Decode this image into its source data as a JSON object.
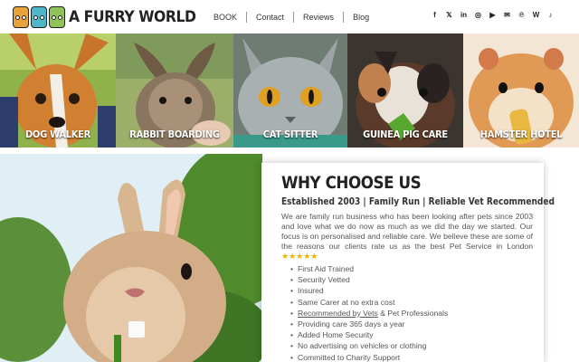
{
  "brand": {
    "name": "A FURRY WORLD"
  },
  "nav": {
    "items": [
      "BOOK",
      "Contact",
      "Reviews",
      "Blog"
    ]
  },
  "social": [
    "f",
    "𝕏",
    "in",
    "◎",
    "▶",
    "✉",
    "℗",
    "W",
    "♪"
  ],
  "social_names": [
    "facebook-icon",
    "x-twitter-icon",
    "linkedin-icon",
    "instagram-icon",
    "youtube-icon",
    "email-icon",
    "pinterest-icon",
    "w-icon",
    "tiktok-icon"
  ],
  "tiles": [
    {
      "label": "DOG WALKER"
    },
    {
      "label": "RABBIT BOARDING"
    },
    {
      "label": "CAT SITTER"
    },
    {
      "label": "GUINEA PIG CARE"
    },
    {
      "label": "HAMSTER HOTEL"
    }
  ],
  "why": {
    "title": "WHY CHOOSE US",
    "subtitle": "Established 2003  | Family Run | Reliable Vet Recommended",
    "body": "We are family run business  who has been looking after pets since 2003 and love what we do now as much as we did the day we started. Our focus is on personalised and reliable care. We believe these are some of the reasons our clients rate us as the best Pet Service in London",
    "stars": "★★★★★",
    "bullets": [
      "First Aid Trained",
      "Security Vetted",
      "Insured",
      "Same Carer at no extra cost",
      "Providing care 365 days a year",
      "Added Home Security",
      "No advertising on vehicles or clothing",
      "Committed to Charity Support"
    ],
    "vets_link": "Recommended by Vets",
    "vets_suffix": " & Pet Professionals"
  },
  "colors": {
    "accent_star": "#f0b400",
    "text": "#555555"
  }
}
